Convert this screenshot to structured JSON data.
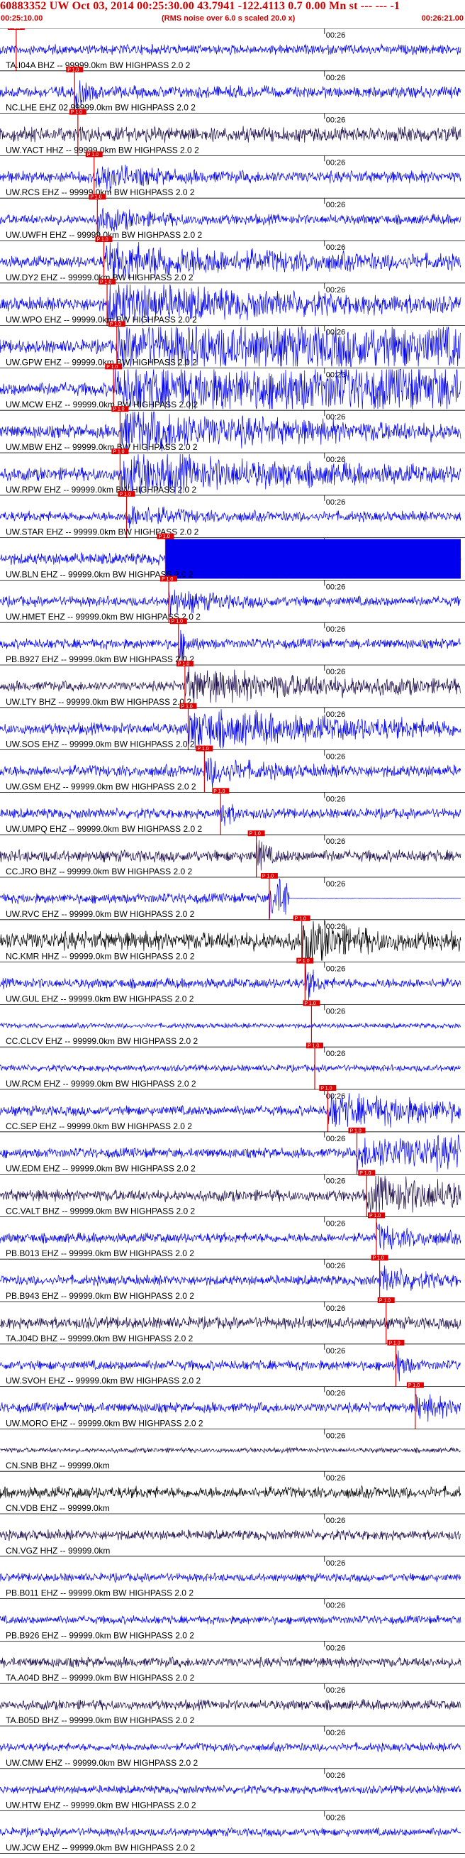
{
  "header": {
    "title": "60883352 UW Oct 03, 2014 00:25:30.00   43.7941 -122.4113  0.7 0.00 Mn st --- --- -1",
    "start_time": "00:25:10.00",
    "note": "(RMS noise over 6.0 s scaled 20.0 x)",
    "end_time": "00:26:21.00"
  },
  "colors": {
    "header_text": "#cc0000",
    "trace_blue": "#0000ee",
    "trace_dark": "#1a0a4a",
    "pick_red": "#dd0000",
    "separator": "#000000"
  },
  "chart_data": {
    "type": "line",
    "title": "60883352 UW Oct 03, 2014 00:25:30.00   43.7941 -122.4113  0.7 0.00 Mn st --- --- -1",
    "xlabel": "",
    "ylabel": "",
    "x_range": [
      "00:25:10.00",
      "00:26:21.00"
    ],
    "x_tick_labels": [
      "00:26"
    ],
    "grid": false,
    "legend": "none",
    "pick_marker_text": "P 1.0",
    "series": [
      {
        "name": "TA.I04A BHZ -- 99999.0km BW HIGHPASS 2.0 2",
        "pick_s": 2.5,
        "amplitude": 0.3,
        "color": "blue",
        "burst": "none"
      },
      {
        "name": "NC.LHE EHZ 02 99999.0km BW HIGHPASS 2.0 2",
        "pick_s": 11.5,
        "amplitude": 0.35,
        "color": "blue",
        "burst": "spike"
      },
      {
        "name": "UW.YACT HHZ -- 99999.0km BW HIGHPASS 2.0 2",
        "pick_s": 12.0,
        "amplitude": 0.45,
        "color": "dark",
        "burst": "none"
      },
      {
        "name": "UW.RCS EHZ -- 99999.0km BW HIGHPASS 2.0 2",
        "pick_s": 14.5,
        "amplitude": 0.35,
        "color": "blue",
        "burst": "medium"
      },
      {
        "name": "UW.UWFH EHZ -- 99999.0km BW HIGHPASS 2.0 2",
        "pick_s": 15.0,
        "amplitude": 0.3,
        "color": "blue",
        "burst": "medium"
      },
      {
        "name": "UW.DY2 EHZ -- 99999.0km BW HIGHPASS 2.0 2",
        "pick_s": 16.0,
        "amplitude": 0.35,
        "color": "blue",
        "burst": "strong"
      },
      {
        "name": "UW.WPO EHZ -- 99999.0km BW HIGHPASS 2.0 2",
        "pick_s": 16.5,
        "amplitude": 0.4,
        "color": "blue",
        "burst": "strong"
      },
      {
        "name": "UW.GPW EHZ -- 99999.0km BW HIGHPASS 2.0 2",
        "pick_s": 18.0,
        "amplitude": 0.4,
        "color": "blue",
        "burst": "saturated"
      },
      {
        "name": "UW.MCW EHZ -- 99999.0km BW HIGHPASS 2.0 2",
        "pick_s": 17.5,
        "amplitude": 0.4,
        "color": "blue",
        "burst": "saturated"
      },
      {
        "name": "UW.MBW EHZ -- 99999.0km BW HIGHPASS 2.0 2",
        "pick_s": 18.5,
        "amplitude": 0.4,
        "color": "blue",
        "burst": "strong"
      },
      {
        "name": "UW.RPW EHZ -- 99999.0km BW HIGHPASS 2.0 2",
        "pick_s": 18.5,
        "amplitude": 0.4,
        "color": "blue",
        "burst": "strong"
      },
      {
        "name": "UW.STAR EHZ -- 99999.0km BW HIGHPASS 2.0 2",
        "pick_s": 19.5,
        "amplitude": 0.3,
        "color": "blue",
        "burst": "medium"
      },
      {
        "name": "UW.BLN EHZ -- 99999.0km BW HIGHPASS 2.0 2",
        "pick_s": 25.5,
        "amplitude": 0.35,
        "color": "blue",
        "burst": "block"
      },
      {
        "name": "UW.HMET EHZ -- 99999.0km BW HIGHPASS 2.0 2",
        "pick_s": 26.0,
        "amplitude": 0.3,
        "color": "blue",
        "burst": "medium"
      },
      {
        "name": "PB.B927 EHZ -- 99999.0km BW HIGHPASS 2.0 2",
        "pick_s": 27.5,
        "amplitude": 0.3,
        "color": "blue",
        "burst": "spike"
      },
      {
        "name": "UW.LTY BHZ -- 99999.0km BW HIGHPASS 2.0 2",
        "pick_s": 28.5,
        "amplitude": 0.3,
        "color": "dark",
        "burst": "strong"
      },
      {
        "name": "UW.SOS EHZ -- 99999.0km BW HIGHPASS 2.0 2",
        "pick_s": 29.0,
        "amplitude": 0.35,
        "color": "blue",
        "burst": "strong"
      },
      {
        "name": "UW.GSM EHZ -- 99999.0km BW HIGHPASS 2.0 2",
        "pick_s": 31.5,
        "amplitude": 0.35,
        "color": "blue",
        "burst": "medium"
      },
      {
        "name": "UW.UMPQ EHZ -- 99999.0km BW HIGHPASS 2.0 2",
        "pick_s": 34.0,
        "amplitude": 0.3,
        "color": "blue",
        "burst": "spike"
      },
      {
        "name": "CC.JRO BHZ -- 99999.0km BW HIGHPASS 2.0 2",
        "pick_s": 39.5,
        "amplitude": 0.35,
        "color": "dark",
        "burst": "spike"
      },
      {
        "name": "UW.RVC EHZ -- 99999.0km BW HIGHPASS 2.0 2",
        "pick_s": 41.5,
        "amplitude": 0.3,
        "color": "blue",
        "burst": "clip"
      },
      {
        "name": "NC.KMR HHZ -- 99999.0km BW HIGHPASS 2.0 2",
        "pick_s": 46.5,
        "amplitude": 0.55,
        "color": "black",
        "burst": "medium"
      },
      {
        "name": "UW.GUL EHZ -- 99999.0km BW HIGHPASS 2.0 2",
        "pick_s": 47.0,
        "amplitude": 0.3,
        "color": "blue",
        "burst": "spike"
      },
      {
        "name": "CC.CLCV EHZ -- 99999.0km BW HIGHPASS 2.0 2",
        "pick_s": 48.0,
        "amplitude": 0.15,
        "color": "blue",
        "burst": "none"
      },
      {
        "name": "UW.RCM EHZ -- 99999.0km BW HIGHPASS 2.0 2",
        "pick_s": 48.5,
        "amplitude": 0.2,
        "color": "blue",
        "burst": "none"
      },
      {
        "name": "CC.SEP EHZ -- 99999.0km BW HIGHPASS 2.0 2",
        "pick_s": 50.5,
        "amplitude": 0.3,
        "color": "blue",
        "burst": "strong"
      },
      {
        "name": "UW.EDM EHZ -- 99999.0km BW HIGHPASS 2.0 2",
        "pick_s": 55.0,
        "amplitude": 0.3,
        "color": "blue",
        "burst": "saturated"
      },
      {
        "name": "CC.VALT BHZ -- 99999.0km BW HIGHPASS 2.0 2",
        "pick_s": 56.5,
        "amplitude": 0.35,
        "color": "dark",
        "burst": "strong"
      },
      {
        "name": "PB.B013 EHZ -- 99999.0km BW HIGHPASS 2.0 2",
        "pick_s": 58.0,
        "amplitude": 0.3,
        "color": "blue",
        "burst": "medium"
      },
      {
        "name": "PB.B943 EHZ -- 99999.0km BW HIGHPASS 2.0 2",
        "pick_s": 58.5,
        "amplitude": 0.3,
        "color": "blue",
        "burst": "medium"
      },
      {
        "name": "TA.J04D BHZ -- 99999.0km BW HIGHPASS 2.0 2",
        "pick_s": 59.5,
        "amplitude": 0.35,
        "color": "dark",
        "burst": "none"
      },
      {
        "name": "UW.SVOH EHZ -- 99999.0km BW HIGHPASS 2.0 2",
        "pick_s": 61.0,
        "amplitude": 0.3,
        "color": "blue",
        "burst": "spike"
      },
      {
        "name": "UW.MORO EHZ -- 99999.0km BW HIGHPASS 2.0 2",
        "pick_s": 64.0,
        "amplitude": 0.3,
        "color": "blue",
        "burst": "medium"
      },
      {
        "name": "CN.SNB BHZ -- 99999.0km",
        "pick_s": null,
        "amplitude": 0.15,
        "color": "dark",
        "burst": "none"
      },
      {
        "name": "CN.VDB EHZ -- 99999.0km",
        "pick_s": null,
        "amplitude": 0.35,
        "color": "black",
        "burst": "none"
      },
      {
        "name": "CN.VGZ HHZ -- 99999.0km",
        "pick_s": null,
        "amplitude": 0.3,
        "color": "dark",
        "burst": "none"
      },
      {
        "name": "PB.B011 EHZ -- 99999.0km BW HIGHPASS 2.0 2",
        "pick_s": null,
        "amplitude": 0.25,
        "color": "blue",
        "burst": "none"
      },
      {
        "name": "PB.B926 EHZ -- 99999.0km BW HIGHPASS 2.0 2",
        "pick_s": null,
        "amplitude": 0.25,
        "color": "blue",
        "burst": "none"
      },
      {
        "name": "TA.A04D BHZ -- 99999.0km BW HIGHPASS 2.0 2",
        "pick_s": null,
        "amplitude": 0.3,
        "color": "dark",
        "burst": "none"
      },
      {
        "name": "TA.B05D BHZ -- 99999.0km BW HIGHPASS 2.0 2",
        "pick_s": null,
        "amplitude": 0.3,
        "color": "dark",
        "burst": "none"
      },
      {
        "name": "UW.CMW EHZ -- 99999.0km BW HIGHPASS 2.0 2",
        "pick_s": null,
        "amplitude": 0.25,
        "color": "blue",
        "burst": "none"
      },
      {
        "name": "UW.HTW EHZ -- 99999.0km BW HIGHPASS 2.0 2",
        "pick_s": null,
        "amplitude": 0.25,
        "color": "blue",
        "burst": "none"
      },
      {
        "name": "UW.JCW EHZ -- 99999.0km BW HIGHPASS 2.0 2",
        "pick_s": null,
        "amplitude": 0.25,
        "color": "blue",
        "burst": "none"
      }
    ]
  }
}
